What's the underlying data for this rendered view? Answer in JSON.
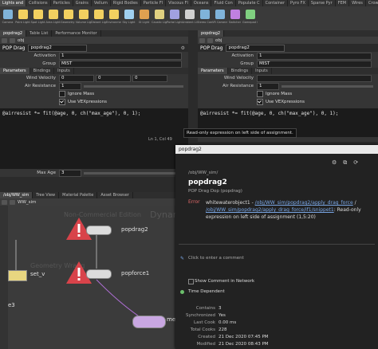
{
  "shelf": {
    "tabs": [
      "Lights and",
      "Collisions",
      "Particles",
      "Grains",
      "Vellum",
      "Rigid Bodies",
      "Particle Fl",
      "Viscous Fl",
      "Oceans",
      "Fluid Con",
      "Populate C",
      "Container",
      "Pyro FX",
      "Sparse Pyr",
      "FEM",
      "Wires",
      "Crowds",
      "Drive Sim"
    ],
    "tools": [
      "Camera",
      "Point Light",
      "Spot Light",
      "Area Light",
      "Geometry Light",
      "Volume Light",
      "Distant Light",
      "Environment Light",
      "Sky Light",
      "GI Light",
      "Caustic Light",
      "Portal Light",
      "Ambient Light",
      "Stereo Camera",
      "VR Camera",
      "Switcher",
      "Gamepad Camera"
    ]
  },
  "left_pane": {
    "tabs": [
      "popdrag2",
      "Table List",
      "Performance Monitor"
    ],
    "path": "obj",
    "type_label": "POP Drag",
    "node_name": "popdrag2",
    "activation_label": "Activation",
    "activation_value": "1",
    "group_label": "Group",
    "group_value": "MIST",
    "subtabs": [
      "Parameters",
      "Bindings",
      "Inputs"
    ],
    "wind_label": "Wind Velocity",
    "wind_values": [
      "0",
      "0",
      "0"
    ],
    "air_label": "Air Resistance",
    "air_value": "1",
    "ignore_mass": "Ignore Mass",
    "use_vex": "Use VEXpressions",
    "code": "@airresist *= fit(@age, 0, ch(\"max_age\"), 0, 1);",
    "maxage_label": "Max Age",
    "maxage_value": "3"
  },
  "right_pane": {
    "tabs": [
      "popdrag2"
    ],
    "path": "obj",
    "type_label": "POP Drag",
    "node_name": "popdrag2",
    "activation_label": "Activation",
    "activation_value": "1",
    "group_label": "Group",
    "group_value": "MIST",
    "subtabs": [
      "Parameters",
      "Bindings",
      "Inputs"
    ],
    "wind_label": "Wind Velocity",
    "air_label": "Air Resistance",
    "air_value": "1",
    "ignore_mass": "Ignore Mass",
    "use_vex": "Use VEXpressions",
    "code": "@airresist *= fit(@age, 0, ch(\"max_age\"), 0, 1);",
    "cursor_info": "Ln 1, Col 49"
  },
  "tooltip": "Read-only expression on left side of assignment.",
  "network": {
    "tabs": [
      "/obj/WW_sim",
      "Tree View",
      "Material Palette",
      "Asset Browser"
    ],
    "path": "WW_sim",
    "watermark1": "Non-Commercial Edition",
    "watermark2": "Dynam",
    "watermark3": "Geometry Wrang",
    "nodes": {
      "popdrag": "popdrag2",
      "popforce": "popforce1",
      "setv": "set_v",
      "e3": "e3",
      "me": "me"
    }
  },
  "popup": {
    "title": "popdrag2",
    "path": "/obj/WW_sim/",
    "node_name": "popdrag2",
    "node_type": "POP Drag Dop (popdrag)",
    "error_label": "Error",
    "error_prefix": "whitewaterobject1 - ",
    "error_link1": "/obj/WW_sim/popdrag2/",
    "error_link2": "apply_drag_force",
    "error_link3": "/obj/WW_sim/popdrag2/",
    "error_link4": "apply_drag_force/if1/snippet1",
    "error_suffix": ": Read-only expression on left side of assignment (1,5:20)",
    "comment_placeholder": "Click to enter a comment",
    "show_comment": "Show Comment in Network",
    "time_dependent": "Time Dependent",
    "time_dependent_value": "No",
    "stats": [
      {
        "label": "Contains",
        "value": "3"
      },
      {
        "label": "Synchronized",
        "value": "Yes"
      },
      {
        "label": "Last Cook",
        "value": "0.00 ms"
      },
      {
        "label": "Total Cooks",
        "value": "228"
      },
      {
        "label": "Created",
        "value": "21 Dec 2020 07:45 PM"
      },
      {
        "label": "Modified",
        "value": "21 Dec 2020 08:43 PM"
      }
    ]
  }
}
